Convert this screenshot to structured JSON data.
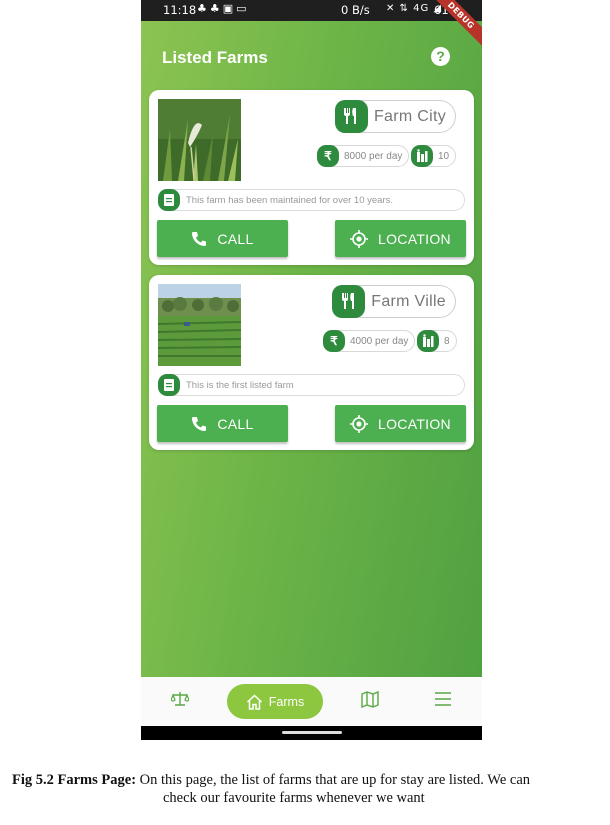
{
  "status_bar": {
    "time": "11:18",
    "left_icons": "♣♣▣▭",
    "net_speed": "0 B/s",
    "signal_icons": "✕ ⇅ 4G ◢",
    "battery": "61%"
  },
  "debug_banner": "DEBUG",
  "header": {
    "title": "Listed Farms",
    "help_icon": "?"
  },
  "farms": [
    {
      "name": "Farm City",
      "price": "8000 per day",
      "capacity": "10",
      "description": "This farm has been maintained for over 10 years.",
      "call_label": "CALL",
      "location_label": "LOCATION"
    },
    {
      "name": "Farm Ville",
      "price": "4000 per day",
      "capacity": "8",
      "description": "This is the first listed farm",
      "call_label": "CALL",
      "location_label": "LOCATION"
    }
  ],
  "icons": {
    "currency": "₹",
    "restaurant": "restaurant-icon",
    "people": "people-icon",
    "document": "document-icon",
    "phone": "phone-icon",
    "location": "gps-icon"
  },
  "bottom_nav": {
    "items": [
      {
        "label": "",
        "icon": "scale-icon"
      },
      {
        "label": "Farms",
        "icon": "home-icon"
      },
      {
        "label": "",
        "icon": "map-icon"
      },
      {
        "label": "",
        "icon": "menu-icon"
      }
    ]
  },
  "caption": {
    "label": "Fig 5.2 Farms Page:",
    "line1": "On this page, the list of farms that are up for stay are listed. We can",
    "line2": "check our favourite farms whenever we want"
  },
  "colors": {
    "accent_green": "#4caf50",
    "dark_green": "#2e8b3e",
    "nav_pill": "#8dc63f",
    "debug_red": "#b8342a"
  }
}
